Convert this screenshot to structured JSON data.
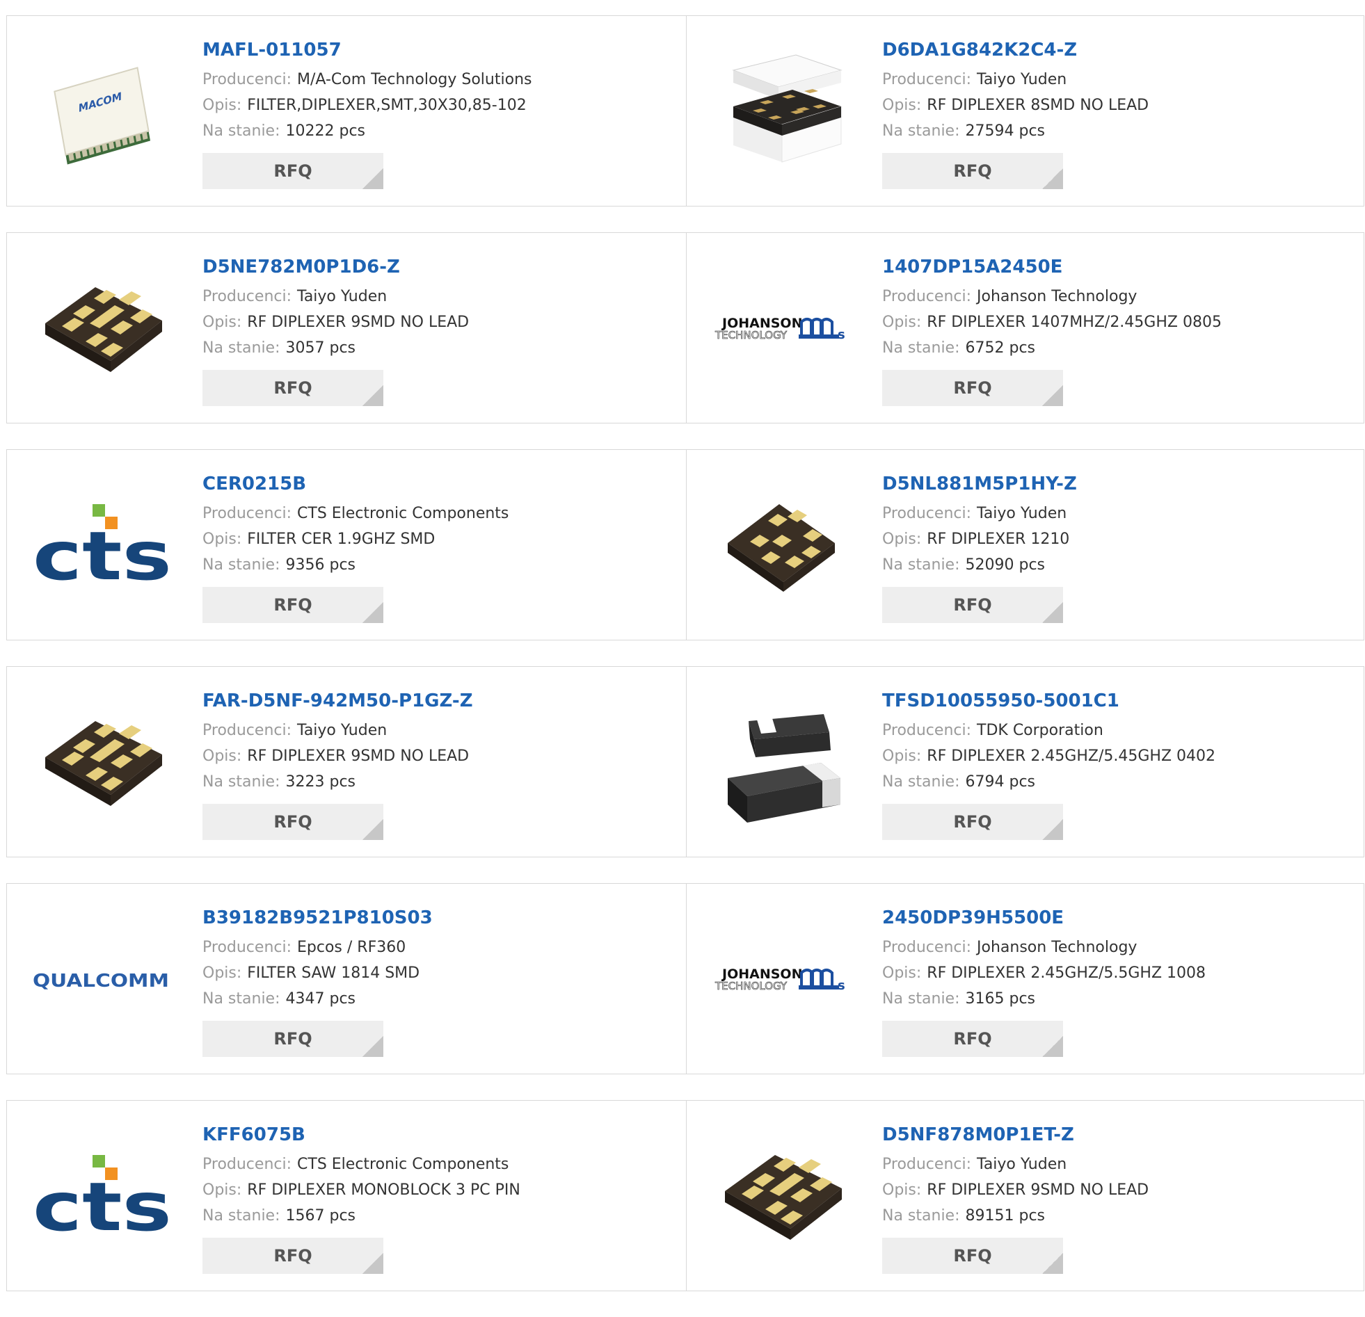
{
  "labels": {
    "producer": "Producenci:",
    "desc": "Opis:",
    "stock": "Na stanie:",
    "rfq": "RFQ"
  },
  "products": [
    {
      "pn": "MAFL-011057",
      "producer": "M/A-Com Technology Solutions",
      "desc": "FILTER,DIPLEXER,SMT,30X30,85-102",
      "stock": "10222 pcs",
      "image": "macom-chip"
    },
    {
      "pn": "D6DA1G842K2C4-Z",
      "producer": "Taiyo Yuden",
      "desc": "RF DIPLEXER 8SMD NO LEAD",
      "stock": "27594 pcs",
      "image": "capped-diplexer-chip"
    },
    {
      "pn": "D5NE782M0P1D6-Z",
      "producer": "Taiyo Yuden",
      "desc": "RF DIPLEXER 9SMD NO LEAD",
      "stock": "3057 pcs",
      "image": "9pad-smd-chip"
    },
    {
      "pn": "1407DP15A2450E",
      "producer": "Johanson Technology",
      "desc": "RF DIPLEXER 1407MHZ/2.45GHZ 0805",
      "stock": "6752 pcs",
      "image": "johanson-logo"
    },
    {
      "pn": "CER0215B",
      "producer": "CTS Electronic Components",
      "desc": "FILTER CER 1.9GHZ SMD",
      "stock": "9356 pcs",
      "image": "cts-logo"
    },
    {
      "pn": "D5NL881M5P1HY-Z",
      "producer": "Taiyo Yuden",
      "desc": "RF DIPLEXER 1210",
      "stock": "52090 pcs",
      "image": "8pad-smd-chip"
    },
    {
      "pn": "FAR-D5NF-942M50-P1GZ-Z",
      "producer": "Taiyo Yuden",
      "desc": "RF DIPLEXER 9SMD NO LEAD",
      "stock": "3223 pcs",
      "image": "9pad-smd-chip"
    },
    {
      "pn": "TFSD10055950-5001C1",
      "producer": "TDK Corporation",
      "desc": "RF DIPLEXER 2.45GHZ/5.45GHZ 0402",
      "stock": "6794 pcs",
      "image": "tdk-chip-pair"
    },
    {
      "pn": "B39182B9521P810S03",
      "producer": "Epcos / RF360",
      "desc": "FILTER SAW 1814 SMD",
      "stock": "4347 pcs",
      "image": "qualcomm-logo"
    },
    {
      "pn": "2450DP39H5500E",
      "producer": "Johanson Technology",
      "desc": "RF DIPLEXER 2.45GHZ/5.5GHZ 1008",
      "stock": "3165 pcs",
      "image": "johanson-logo"
    },
    {
      "pn": "KFF6075B",
      "producer": "CTS Electronic Components",
      "desc": "RF DIPLEXER MONOBLOCK 3 PC PIN",
      "stock": "1567 pcs",
      "image": "cts-logo"
    },
    {
      "pn": "D5NF878M0P1ET-Z",
      "producer": "Taiyo Yuden",
      "desc": "RF DIPLEXER 9SMD NO LEAD",
      "stock": "89151 pcs",
      "image": "9pad-smd-chip"
    }
  ],
  "logos": {
    "macom": "MACOM",
    "johanson_line1": "JOHANSON",
    "johanson_line2": "TECHNOLOGY",
    "qualcomm": "QUALCOMM"
  },
  "colors": {
    "link": "#1e63b3",
    "label": "#9a9a9a",
    "button_bg": "#eeeeee",
    "cts_blue": "#16457a",
    "cts_green": "#78b843",
    "cts_orange": "#f29121",
    "qualcomm_blue": "#2a5ea8"
  }
}
